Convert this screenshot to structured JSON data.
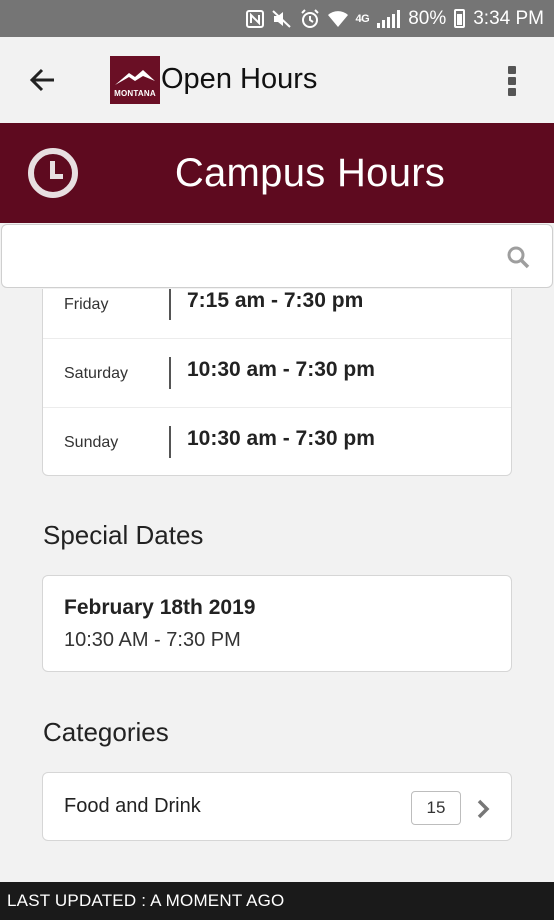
{
  "status_bar": {
    "battery": "80%",
    "time": "3:34 PM",
    "network": "4G",
    "icons": [
      "nfc-icon",
      "mute-icon",
      "alarm-icon",
      "wifi-icon",
      "signal-icon",
      "battery-icon"
    ]
  },
  "app_bar": {
    "title": "Open Hours",
    "logo_text": "MONTANA",
    "back_icon": "arrow-left-icon",
    "menu_icon": "more-vert-icon"
  },
  "hero": {
    "title": "Campus Hours",
    "icon": "clock-icon",
    "color": "#5e0a1f"
  },
  "search": {
    "placeholder": "",
    "value": "",
    "icon": "search-icon"
  },
  "hours": [
    {
      "day": "Friday",
      "time": "7:15 am - 7:30 pm"
    },
    {
      "day": "Saturday",
      "time": "10:30 am - 7:30 pm"
    },
    {
      "day": "Sunday",
      "time": "10:30 am - 7:30 pm"
    }
  ],
  "special_dates": {
    "title": "Special Dates",
    "items": [
      {
        "date": "February 18th 2019",
        "range": "10:30 AM - 7:30 PM"
      }
    ]
  },
  "categories": {
    "title": "Categories",
    "items": [
      {
        "label": "Food and Drink",
        "count": "15"
      }
    ]
  },
  "footer": {
    "text": "LAST UPDATED : A MOMENT AGO"
  }
}
